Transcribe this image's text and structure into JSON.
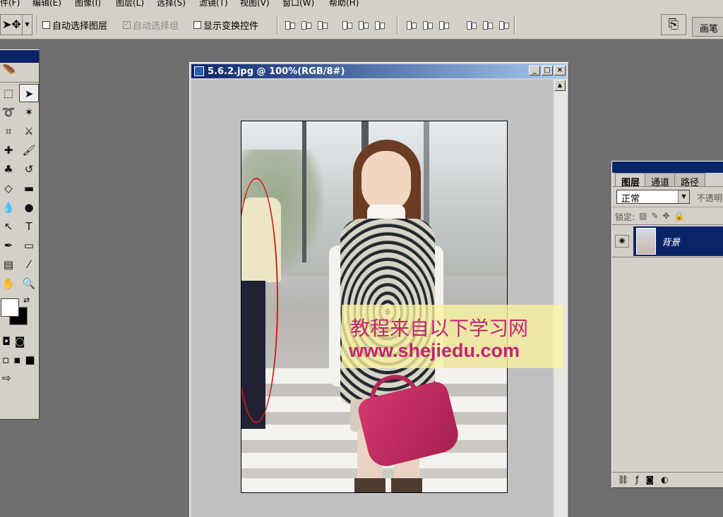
{
  "menu": {
    "items": [
      "件(F)",
      "编辑(E)",
      "图像(I)",
      "图层(L)",
      "选择(S)",
      "滤镜(T)",
      "视图(V)",
      "窗口(W)",
      "帮助(H)"
    ]
  },
  "options_bar": {
    "auto_select_layer": "自动选择图层",
    "auto_select_group": "自动选择组",
    "show_transform_controls": "显示变换控件",
    "brush_tab": "画笔"
  },
  "document": {
    "title": "5.6.2.jpg @ 100%(RGB/8#)"
  },
  "watermark": {
    "line1": "教程来自以下学习网",
    "line2": "www.shejiedu.com",
    "color": "#c42375"
  },
  "layers_panel": {
    "tabs": [
      "图层",
      "通道",
      "路径"
    ],
    "blend_mode": "正常",
    "opacity_label": "不透明",
    "lock_label": "锁定:",
    "layer_name": "背景"
  },
  "colors": {
    "title_bar": "#0a246a",
    "ellipse": "#d41c1c"
  }
}
